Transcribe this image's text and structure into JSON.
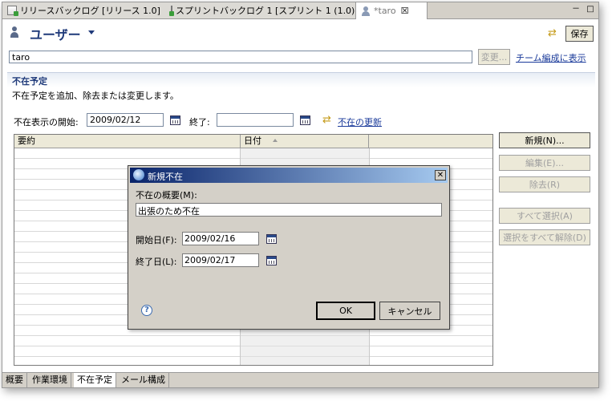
{
  "tabs": [
    {
      "label": "リリースバックログ [リリース 1.0]"
    },
    {
      "label": "スプリントバックログ 1 [スプリント 1 (1.0)]"
    },
    {
      "label": "*taro",
      "close": "☒"
    }
  ],
  "window": {
    "minimize": "－",
    "maximize": "□"
  },
  "header": {
    "title": "ユーザー",
    "save_label": "保存"
  },
  "user": {
    "name_value": "taro",
    "change_label": "変更...",
    "team_link": "チーム編成に表示"
  },
  "section": {
    "title": "不在予定",
    "description": "不在予定を追加、除去または変更します。",
    "range_label": "不在表示の開始:",
    "start_value": "2009/02/12",
    "end_label": "終了:",
    "end_value": "",
    "update_link": "不在の更新"
  },
  "table": {
    "columns": [
      "要約",
      "日付",
      ""
    ]
  },
  "side_buttons": {
    "new": "新規(N)...",
    "edit": "編集(E)...",
    "remove": "除去(R)",
    "select_all": "すべて選択(A)",
    "deselect_all": "選択をすべて解除(D)"
  },
  "bottom_tabs": [
    "概要",
    "作業環境",
    "不在予定",
    "メール構成"
  ],
  "dialog": {
    "title": "新規不在",
    "close": "✕",
    "summary_label": "不在の概要(M):",
    "summary_value": "出張のため不在",
    "start_label": "開始日(F):",
    "start_value": "2009/02/16",
    "end_label": "終了日(L):",
    "end_value": "2009/02/17",
    "help": "?",
    "ok_label": "OK",
    "cancel_label": "キャンセル"
  }
}
